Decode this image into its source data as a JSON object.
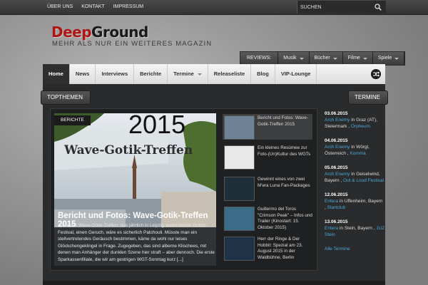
{
  "topbar": {
    "links": [
      "ÜBER UNS",
      "KONTAKT",
      "IMPRESSUM"
    ],
    "search_placeholder": "SUCHEN"
  },
  "logo": {
    "part1": "Deep",
    "part2": "Ground"
  },
  "tagline": "MEHR ALS NUR EIN WEITERES MAGAZIN",
  "reviews": {
    "label": "REVIEWS:",
    "items": [
      "Musik",
      "Bücher",
      "Filme",
      "Spiele"
    ]
  },
  "nav": {
    "items": [
      {
        "label": "Home",
        "active": true,
        "dropdown": false
      },
      {
        "label": "News",
        "active": false,
        "dropdown": false
      },
      {
        "label": "Interviews",
        "active": false,
        "dropdown": false
      },
      {
        "label": "Berichte",
        "active": false,
        "dropdown": false
      },
      {
        "label": "Termine",
        "active": false,
        "dropdown": true
      },
      {
        "label": "Releaseliste",
        "active": false,
        "dropdown": false
      },
      {
        "label": "Blog",
        "active": false,
        "dropdown": false
      },
      {
        "label": "VIP-Lounge",
        "active": false,
        "dropdown": false
      }
    ]
  },
  "sections": {
    "topthemen": "TOPTHEMEN",
    "termine": "TERMINE"
  },
  "featured": {
    "category": "BERICHTE",
    "image_year": "2015",
    "image_banner": "Wave-Gotik-Treffen",
    "title": "Bericht und Fotos: Wave-Gotik-Treffen 2015",
    "excerpt": "Hätte das Wave-Gotik-Treffen, das jährlich in Leipzig stattfindende Gothic-Festival, einen Geruch, wäre es sicherlich Patchouli. Müsste man ein stellvertretendes Geräusch bestimmen, käme da wohl nur leises Glöckchengeklingel in Frage. Zugegeben, das sind alberne Klischees, mit denen man Anhänger der dunklen Szene hier straft – aber dennoch. Die erste Sparkassenfiliale, die wir am gestrigen WGT-Sonntag kurz [...]"
  },
  "side_articles": [
    {
      "title": "Bericht und Fotos: Wave-Gotik-Treffen 2015",
      "thumb_color": "#6d8294"
    },
    {
      "title": "Ein kleines Resümee zur Foto-(Un)Kultur des WGTs",
      "thumb_color": "#e8e8e8"
    },
    {
      "title": "Gewinnt eines von zwei M'era Luna Fan-Packages",
      "thumb_color": "#1e2f3a"
    },
    {
      "title": "Guillermo del Toros \"Crimson Peak\" – Infos und Trailer (Kinostart: 15. Oktober 2015)",
      "thumb_color": "#3a6c88"
    },
    {
      "title": "Herr der Ringe & Der Hobbit: Spezial am 23. August 2015 in der Waldbühne, Berlin",
      "thumb_color": "#1f3348"
    }
  ],
  "termine": [
    {
      "date": "03.06.2015",
      "band": "Arch Enemy",
      "place": " in Graz (AT), Steiermark , ",
      "venue": "Orpheum"
    },
    {
      "date": "04.06.2015",
      "band": "Arch Enemy",
      "place": " in Wörgl, Österreich , ",
      "venue": "Komma"
    },
    {
      "date": "05.06.2015",
      "band": "Arch Enemy",
      "place": " in Geiselwind, Bayern , ",
      "venue": "Out & Loud Festival"
    },
    {
      "date": "12.06.2015",
      "band": "Entera",
      "place": " in Uffenheim, Bayern , ",
      "venue": "Startclub"
    },
    {
      "date": "13.06.2015",
      "band": "Entera",
      "place": " in Stein, Bayern , ",
      "venue": "JUZ Stein"
    }
  ],
  "termine_all": "Alle Termine",
  "colors": {
    "accent_red": "#b01515",
    "link_blue": "#4aa8d8",
    "dark_panel": "#2a2b2c"
  }
}
